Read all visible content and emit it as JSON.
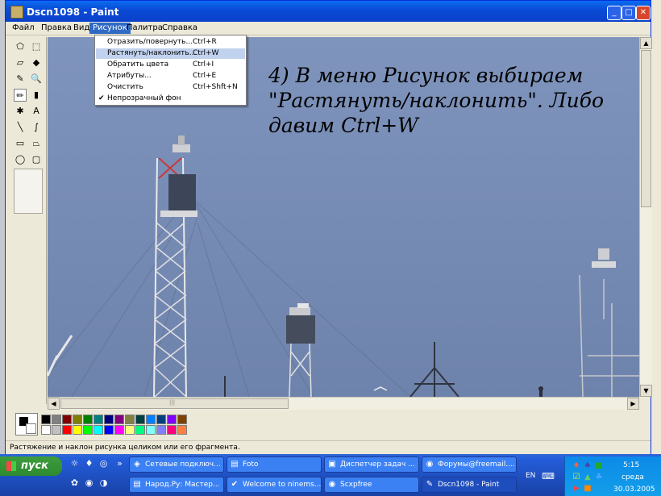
{
  "window": {
    "title": "Dscn1098 - Paint",
    "min_glyph": "_",
    "max_glyph": "□",
    "close_glyph": "✕"
  },
  "menubar": {
    "items": [
      "Файл",
      "Правка",
      "Вид",
      "Рисунок",
      "Палитра",
      "Справка"
    ],
    "active": "Рисунок"
  },
  "dropdown": {
    "items": [
      {
        "label": "Отразить/повернуть...",
        "shortcut": "Ctrl+R",
        "highlighted": false,
        "checked": false
      },
      {
        "label": "Растянуть/наклонить...",
        "shortcut": "Ctrl+W",
        "highlighted": true,
        "checked": false
      },
      {
        "label": "Обратить цвета",
        "shortcut": "Ctrl+I",
        "highlighted": false,
        "checked": false
      },
      {
        "label": "Атрибуты...",
        "shortcut": "Ctrl+E",
        "highlighted": false,
        "checked": false
      },
      {
        "label": "Очистить",
        "shortcut": "Ctrl+Shft+N",
        "highlighted": false,
        "checked": false
      },
      {
        "label": "Непрозрачный фон",
        "shortcut": "",
        "highlighted": false,
        "checked": true
      }
    ],
    "check_glyph": "✔"
  },
  "tools": {
    "glyphs": [
      "⬠",
      "⬚",
      "▱",
      "◆",
      "✎",
      "🔍",
      "✏",
      "▮",
      "✱",
      "A",
      "╲",
      "∫",
      "▭",
      "⏢",
      "◯",
      "▢"
    ],
    "names": [
      "free-select",
      "rect-select",
      "eraser",
      "fill",
      "color-picker",
      "magnifier",
      "pencil",
      "brush",
      "airbrush",
      "text",
      "line",
      "curve",
      "rectangle",
      "polygon",
      "ellipse",
      "rounded-rectangle"
    ],
    "selected_index": 6
  },
  "canvas": {
    "caption_lines": [
      "4) В меню Рисунок выбираем",
      "\"Растянуть/наклонить\". Либо",
      "давим Ctrl+W"
    ]
  },
  "scroll": {
    "up": "▲",
    "down": "▼",
    "left": "◀",
    "right": "▶",
    "grip": "|||"
  },
  "palette": {
    "row1": [
      "#000000",
      "#808080",
      "#800000",
      "#808000",
      "#008000",
      "#008080",
      "#000080",
      "#800080",
      "#808040",
      "#004040",
      "#0080ff",
      "#004080",
      "#8000ff",
      "#804000"
    ],
    "row2": [
      "#ffffff",
      "#c0c0c0",
      "#ff0000",
      "#ffff00",
      "#00ff00",
      "#00ffff",
      "#0000ff",
      "#ff00ff",
      "#ffff80",
      "#00ff80",
      "#80ffff",
      "#8080ff",
      "#ff0080",
      "#ff8040"
    ]
  },
  "status": {
    "text": "Растяжение и наклон рисунка целиком или его фрагмента."
  },
  "taskbar": {
    "start_label": "пуск",
    "quicklaunch": [
      "☼",
      "♦",
      "◎",
      "✿",
      "◉",
      "◑"
    ],
    "more": "»",
    "buttons_row1": [
      {
        "label": "Сетевые подключ...",
        "icon": "◈",
        "active": false
      },
      {
        "label": "Foto",
        "icon": "▤",
        "active": false
      },
      {
        "label": "Диспетчер задач ...",
        "icon": "▣",
        "active": false
      },
      {
        "label": "Форумы@freemail....",
        "icon": "◉",
        "active": false
      }
    ],
    "buttons_row2": [
      {
        "label": "Народ.Ру: Мастер...",
        "icon": "▤",
        "active": false
      },
      {
        "label": "Welcome to ninems...",
        "icon": "✔",
        "active": false
      },
      {
        "label": "Scxpfree",
        "icon": "◉",
        "active": false
      },
      {
        "label": "Dscn1098 - Paint",
        "icon": "✎",
        "active": true
      }
    ],
    "lang": "EN"
  },
  "tray": {
    "icons": [
      "♦",
      "♠",
      "■",
      "☑",
      "▲",
      "♣",
      "▶",
      "■"
    ],
    "time": "5:15",
    "day": "среда",
    "date": "30.03.2005"
  }
}
